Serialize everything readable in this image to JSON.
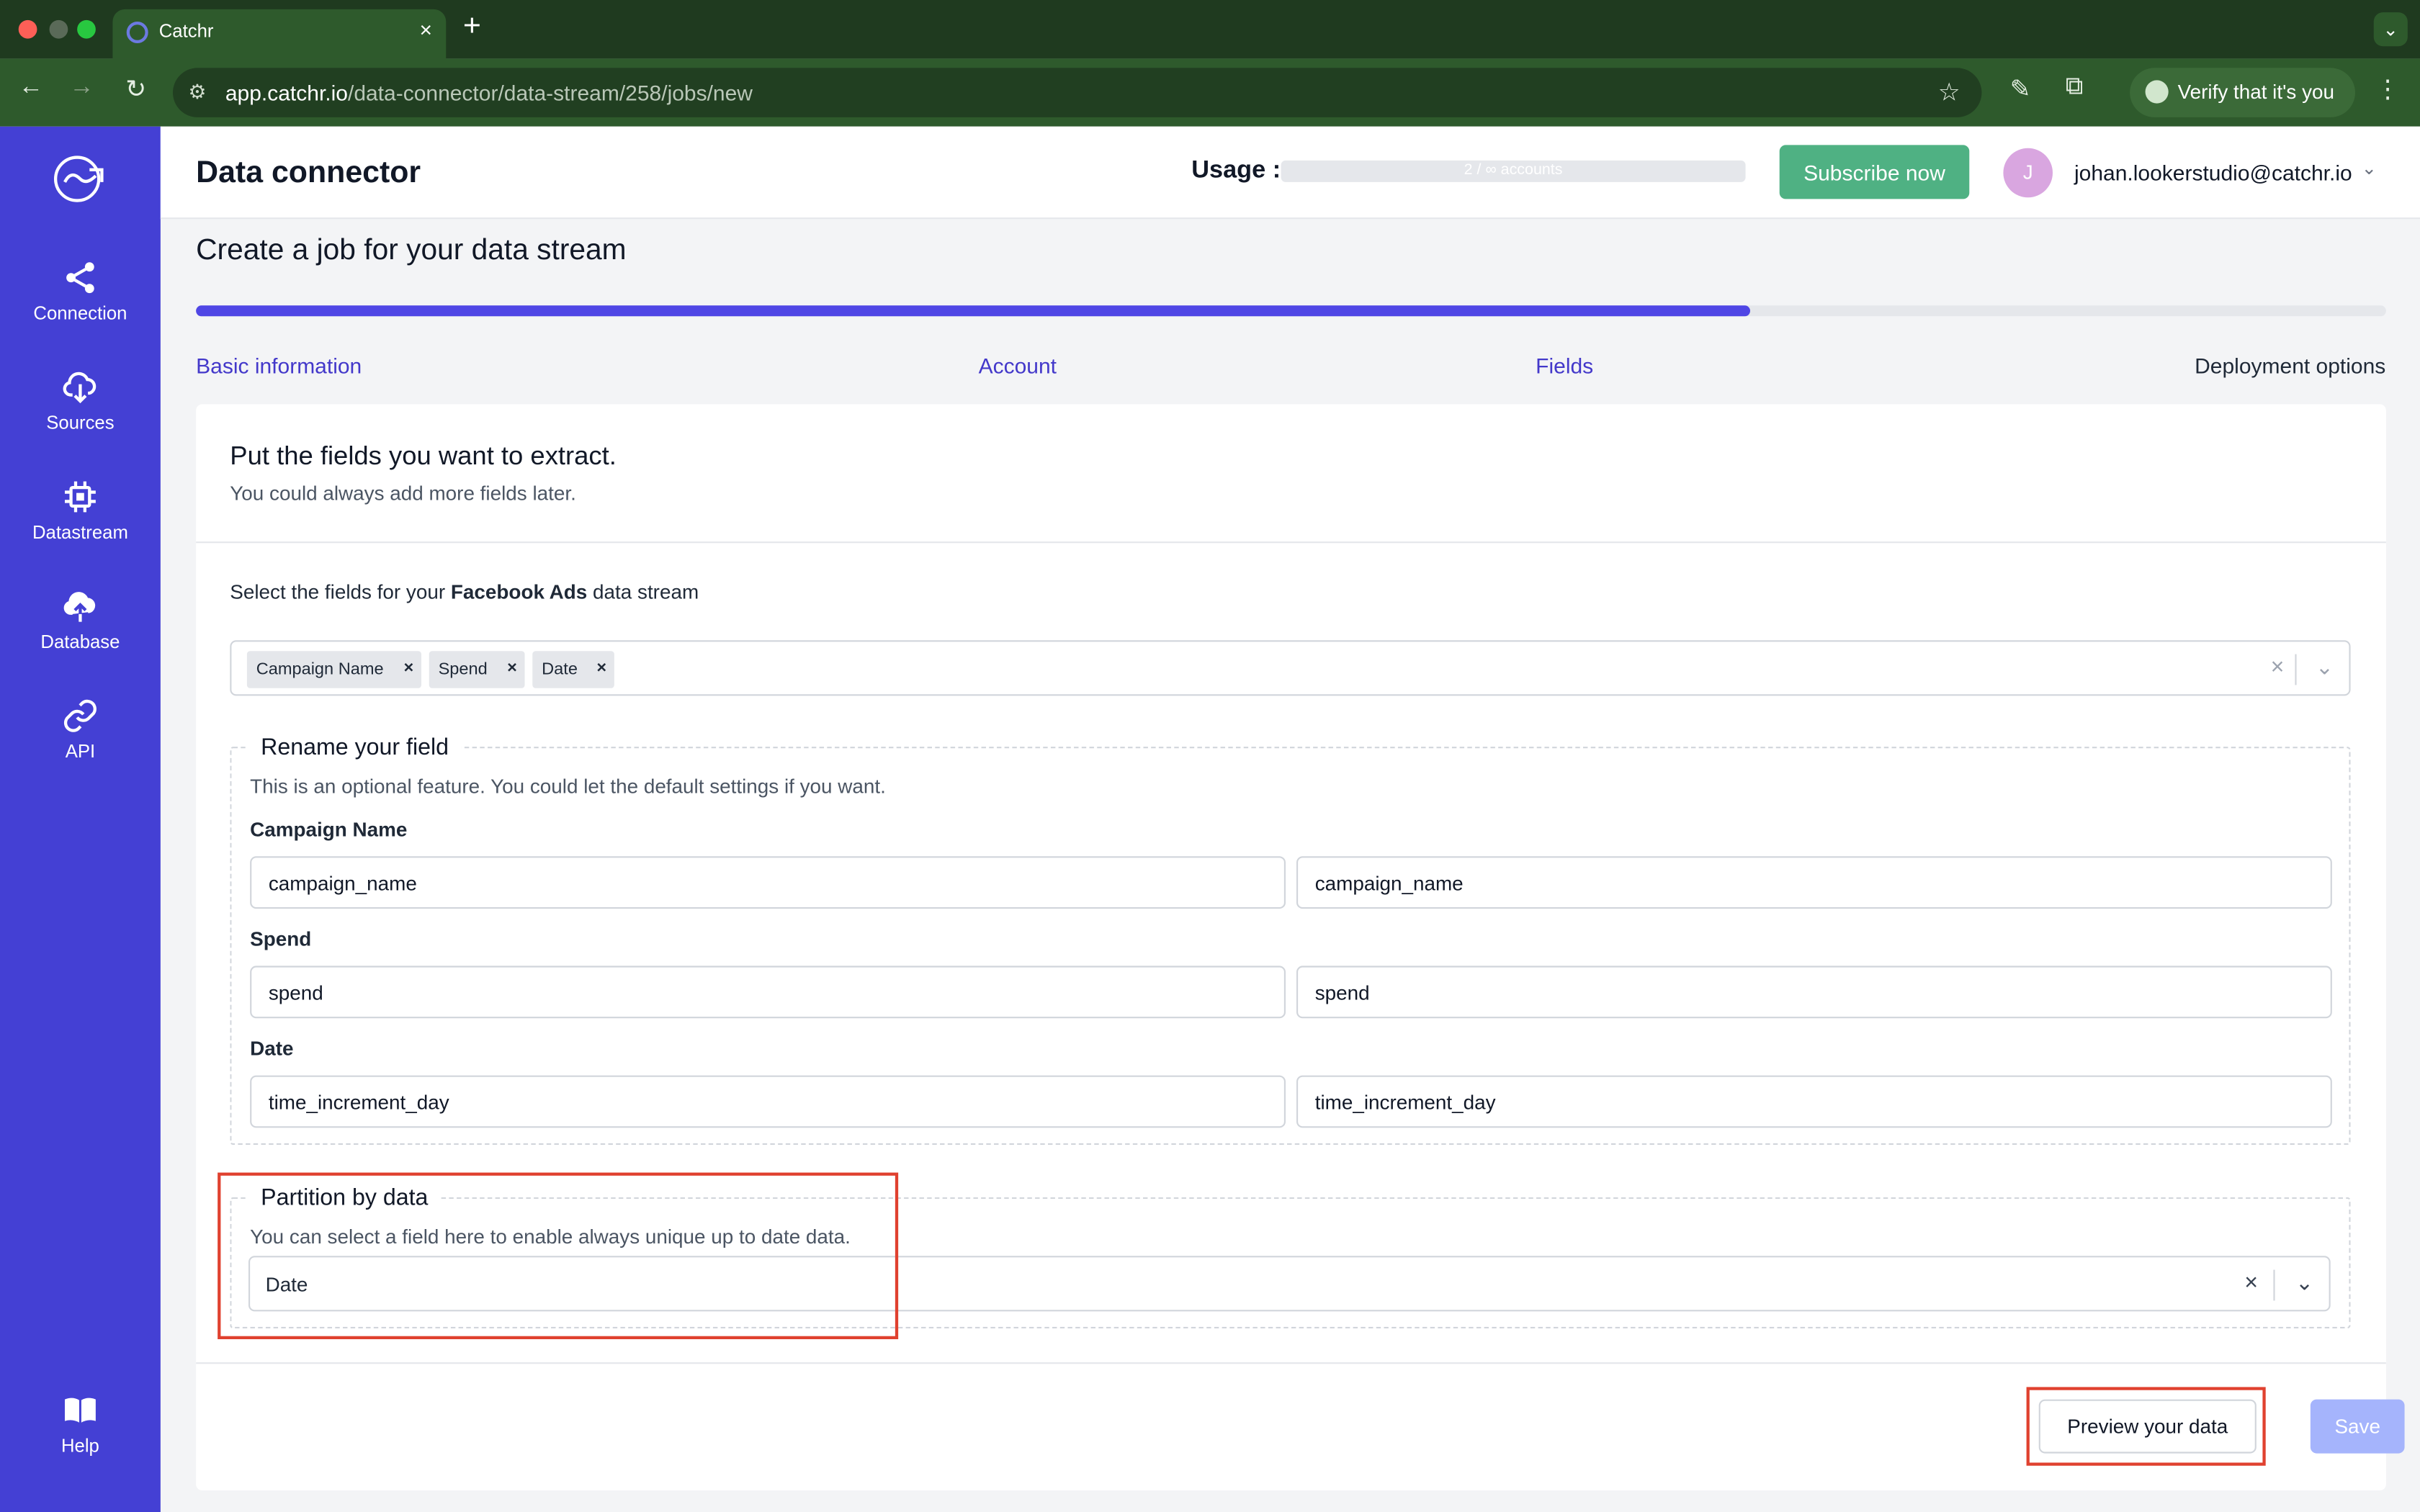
{
  "browser": {
    "tab_title": "Catchr",
    "new_tab_symbol": "+",
    "url_host": "app.catchr.io",
    "url_path": "/data-connector/data-stream/258/jobs/new",
    "verify_label": "Verify that it's you",
    "colors": {
      "frame": "#1f3a1f",
      "toolbar": "#2e5a2c"
    }
  },
  "sidebar": {
    "color": "#4440d4",
    "items": [
      {
        "label": "Connection",
        "icon": "share-icon"
      },
      {
        "label": "Sources",
        "icon": "cloud-download-icon"
      },
      {
        "label": "Datastream",
        "icon": "chip-icon"
      },
      {
        "label": "Database",
        "icon": "cloud-upload-icon"
      },
      {
        "label": "API",
        "icon": "link-icon"
      }
    ],
    "help": {
      "label": "Help",
      "icon": "book-icon"
    }
  },
  "header": {
    "title": "Data connector",
    "usage_label": "Usage :",
    "usage_text": "2 / ∞ accounts",
    "subscribe_label": "Subscribe now",
    "avatar_initial": "J",
    "user_email": "johan.lookerstudio@catchr.io"
  },
  "main": {
    "page_title": "Create a job for your data stream",
    "progress_fraction": 0.71,
    "steps": [
      {
        "label": "Basic information",
        "state": "done"
      },
      {
        "label": "Account",
        "state": "done"
      },
      {
        "label": "Fields",
        "state": "current"
      },
      {
        "label": "Deployment options",
        "state": "pending"
      }
    ],
    "card": {
      "title": "Put the fields you want to extract.",
      "subtitle": "You could always add more fields later.",
      "select_prefix": "Select the fields for your",
      "select_source": "Facebook Ads",
      "select_suffix": "data stream",
      "chips": [
        "Campaign Name",
        "Spend",
        "Date"
      ],
      "rename": {
        "legend": "Rename your field",
        "note": "This is an optional feature. You could let the default settings if you want.",
        "fields": [
          {
            "label": "Campaign Name",
            "original": "campaign_name",
            "renamed": "campaign_name"
          },
          {
            "label": "Spend",
            "original": "spend",
            "renamed": "spend"
          },
          {
            "label": "Date",
            "original": "time_increment_day",
            "renamed": "time_increment_day"
          }
        ]
      },
      "partition": {
        "legend": "Partition by data",
        "note": "You can select a field here to enable always unique up to date data.",
        "value": "Date"
      },
      "preview_label": "Preview your data",
      "save_label": "Save"
    }
  }
}
